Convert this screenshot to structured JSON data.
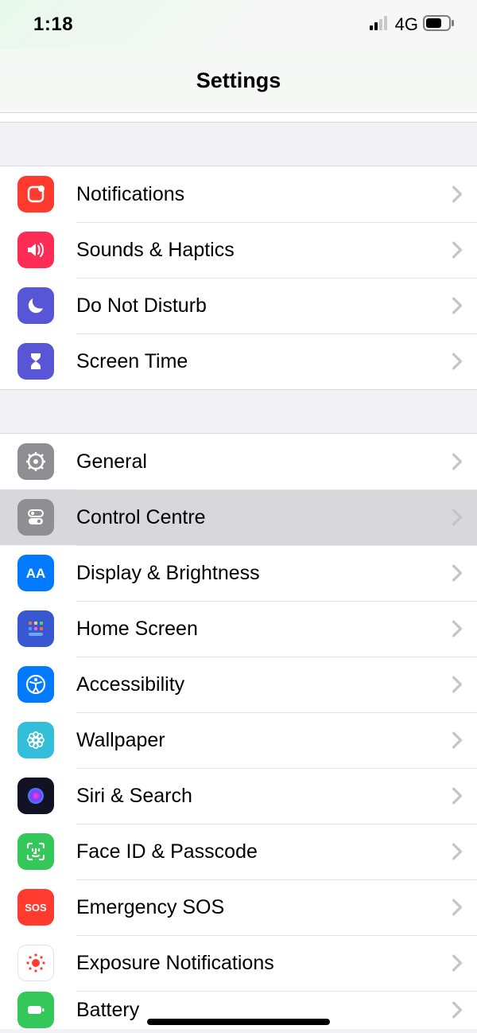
{
  "status": {
    "time": "1:18",
    "network": "4G"
  },
  "header": {
    "title": "Settings"
  },
  "groups": [
    {
      "items": [
        {
          "key": "notifications",
          "label": "Notifications",
          "icon": "notifications-icon",
          "bg": "#ff3b30"
        },
        {
          "key": "sounds",
          "label": "Sounds & Haptics",
          "icon": "speaker-icon",
          "bg": "#ff2d55"
        },
        {
          "key": "dnd",
          "label": "Do Not Disturb",
          "icon": "moon-icon",
          "bg": "#5856d6"
        },
        {
          "key": "screentime",
          "label": "Screen Time",
          "icon": "hourglass-icon",
          "bg": "#5856d6"
        }
      ]
    },
    {
      "items": [
        {
          "key": "general",
          "label": "General",
          "icon": "gear-icon",
          "bg": "#8e8e93"
        },
        {
          "key": "control-centre",
          "label": "Control Centre",
          "icon": "toggles-icon",
          "bg": "#8e8e93",
          "selected": true
        },
        {
          "key": "display",
          "label": "Display & Brightness",
          "icon": "aa-icon",
          "bg": "#007aff"
        },
        {
          "key": "home-screen",
          "label": "Home Screen",
          "icon": "apps-grid-icon",
          "bg": "#3758d1"
        },
        {
          "key": "accessibility",
          "label": "Accessibility",
          "icon": "accessibility-icon",
          "bg": "#007aff"
        },
        {
          "key": "wallpaper",
          "label": "Wallpaper",
          "icon": "flower-icon",
          "bg": "#33bfd9"
        },
        {
          "key": "siri",
          "label": "Siri & Search",
          "icon": "siri-icon",
          "bg": "#121225"
        },
        {
          "key": "faceid",
          "label": "Face ID & Passcode",
          "icon": "faceid-icon",
          "bg": "#34c759"
        },
        {
          "key": "sos",
          "label": "Emergency SOS",
          "icon": "sos-icon",
          "bg": "#ff3b30"
        },
        {
          "key": "exposure",
          "label": "Exposure Notifications",
          "icon": "exposure-icon",
          "bg": "#ffffff",
          "fg": "#ff3b30"
        },
        {
          "key": "battery",
          "label": "Battery",
          "icon": "battery-icon",
          "bg": "#34c759"
        }
      ]
    }
  ]
}
